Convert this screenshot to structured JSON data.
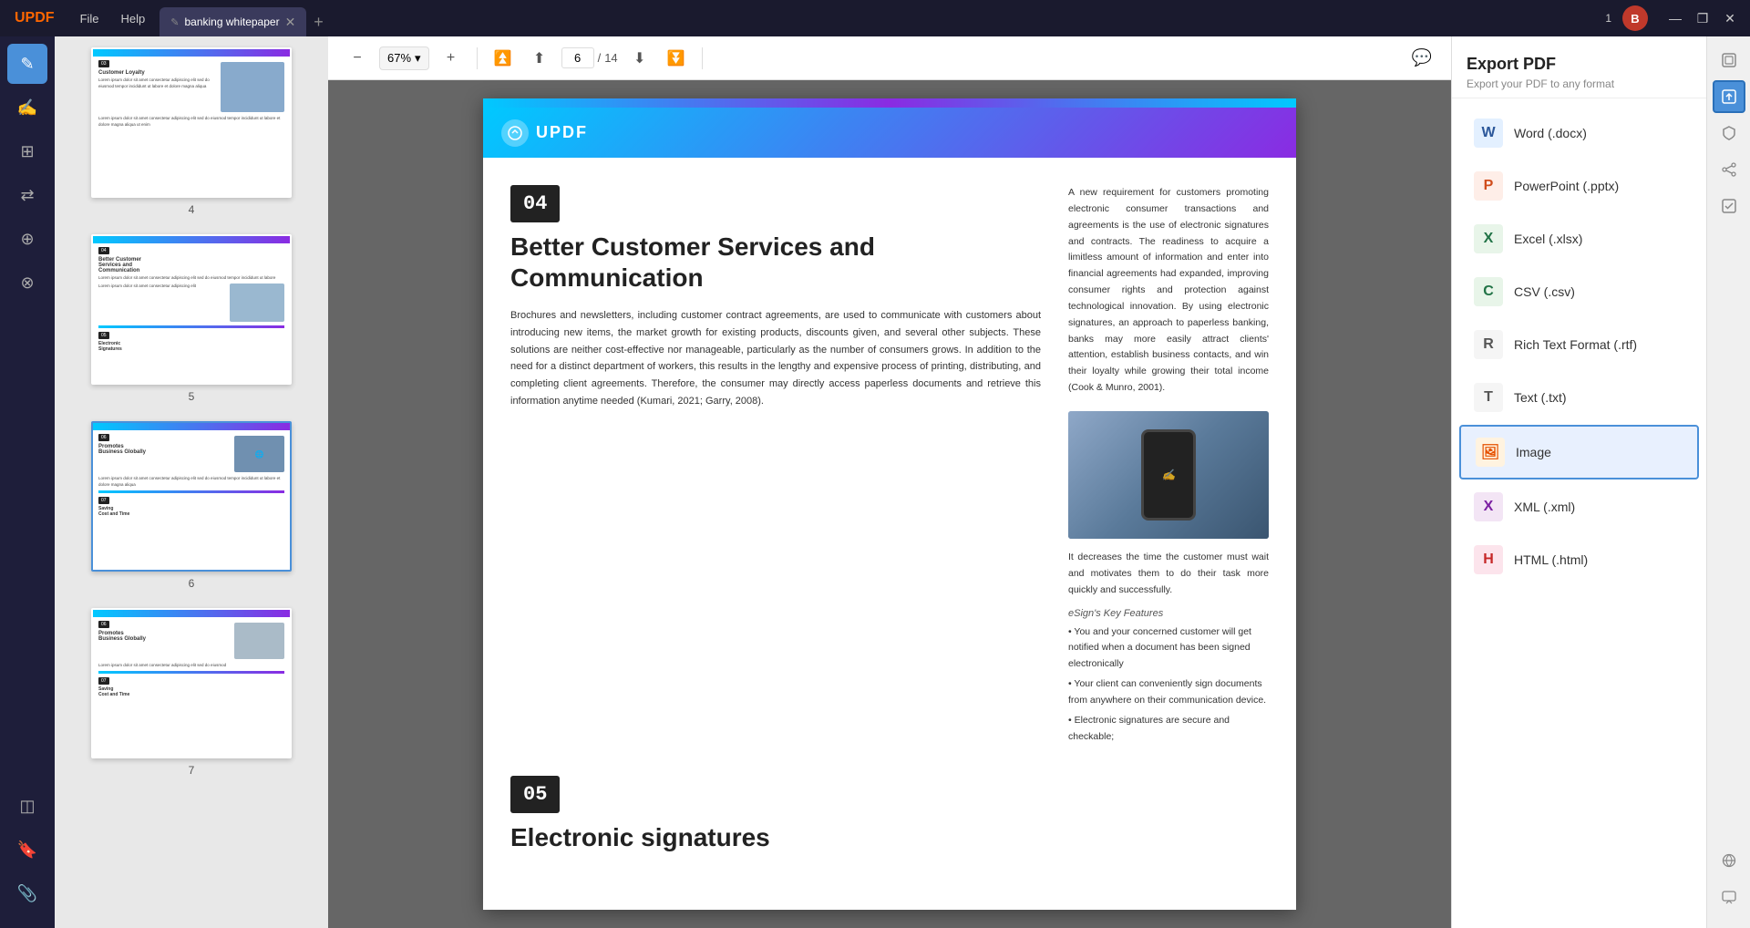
{
  "titlebar": {
    "logo": "UPDF",
    "menu": [
      "File",
      "Help"
    ],
    "tab": {
      "label": "banking whitepaper",
      "icon": "✎"
    },
    "add_tab_label": "+",
    "user_initial": "B",
    "window_controls": {
      "minimize": "—",
      "maximize": "❐",
      "close": "✕"
    },
    "page_indicator": "1"
  },
  "toolbar": {
    "zoom_out_label": "−",
    "zoom_in_label": "+",
    "zoom_level": "67%",
    "zoom_dropdown": "▾",
    "first_page_label": "⏮",
    "prev_page_label": "⬆",
    "next_page_label": "⬇",
    "last_page_label": "⏭",
    "current_page": "6",
    "total_pages": "14",
    "comment_label": "💬"
  },
  "right_panel": {
    "title": "Export PDF",
    "subtitle": "Export your PDF to any format",
    "items": [
      {
        "id": "word",
        "label": "Word (.docx)",
        "icon_text": "W",
        "icon_class": "export-icon-word"
      },
      {
        "id": "powerpoint",
        "label": "PowerPoint (.pptx)",
        "icon_text": "P",
        "icon_class": "export-icon-ppt"
      },
      {
        "id": "excel",
        "label": "Excel (.xlsx)",
        "icon_text": "X",
        "icon_class": "export-icon-excel"
      },
      {
        "id": "csv",
        "label": "CSV (.csv)",
        "icon_text": "C",
        "icon_class": "export-icon-csv"
      },
      {
        "id": "rtf",
        "label": "Rich Text Format (.rtf)",
        "icon_text": "R",
        "icon_class": "export-icon-rtf"
      },
      {
        "id": "txt",
        "label": "Text (.txt)",
        "icon_text": "T",
        "icon_class": "export-icon-txt"
      },
      {
        "id": "image",
        "label": "Image",
        "icon_text": "🖼",
        "icon_class": "export-icon-image",
        "active": true
      },
      {
        "id": "xml",
        "label": "XML (.xml)",
        "icon_text": "X",
        "icon_class": "export-icon-xml"
      },
      {
        "id": "html",
        "label": "HTML (.html)",
        "icon_text": "H",
        "icon_class": "export-icon-html"
      }
    ]
  },
  "pdf_page": {
    "updf_logo": "UPDF",
    "section04": {
      "number": "04",
      "title": "Better Customer Services and Communication",
      "body_left": "Brochures and newsletters, including customer contract agreements, are used to communicate with customers about introducing new items, the market growth for existing products, discounts given, and several other subjects. These solutions are neither cost-effective nor manageable, particularly as the number of consumers grows. In addition to the need for a distinct department of workers, this results in the lengthy and expensive process of printing, distributing, and completing client agreements. Therefore, the consumer may directly access paperless documents and retrieve this information anytime needed (Kumari, 2021; Garry, 2008).",
      "body_right": "A new requirement for customers promoting electronic consumer transactions and agreements is the use of electronic signatures and contracts. The readiness to acquire a limitless amount of information and enter into financial agreements had expanded, improving consumer rights and protection against technological innovation. By using electronic signatures, an approach to paperless banking, banks may more easily attract clients' attention, establish business contacts, and win their loyalty while growing their total income (Cook & Munro, 2001).",
      "image_caption": "",
      "decrease_text": "It decreases the time the customer must wait and motivates them to do their task more quickly and successfully.",
      "esign_title": "eSign's Key Features",
      "bullet1": "• You and your concerned customer will get notified when a document has been signed electronically",
      "bullet2": "• Your client can conveniently sign documents from anywhere on their communication device.",
      "bullet3": "• Electronic signatures are secure and checkable;"
    },
    "section05": {
      "number": "05",
      "title": "Electronic signatures"
    }
  },
  "thumbnails": [
    {
      "page_num": "4",
      "label": "4",
      "section_title": "Customer Loyalty",
      "section_num": "03"
    },
    {
      "page_num": "5",
      "label": "5",
      "section_title": "Better Customer Services and Communication",
      "section_num": "04"
    },
    {
      "page_num": "6",
      "label": "6",
      "section_title": "Electronic Signatures",
      "section_num": "05"
    },
    {
      "page_num": "7",
      "label": "7",
      "section_title": "Promotes Business Globally",
      "section_num": "06"
    }
  ],
  "sidebar": {
    "icons": [
      {
        "id": "edit",
        "symbol": "✎",
        "active": true
      },
      {
        "id": "annotate",
        "symbol": "✍",
        "active": false
      },
      {
        "id": "pages",
        "symbol": "⊞",
        "active": false
      },
      {
        "id": "convert",
        "symbol": "⇄",
        "active": false
      },
      {
        "id": "ocr",
        "symbol": "⊕",
        "active": false
      },
      {
        "id": "stamp",
        "symbol": "⊗",
        "active": false
      }
    ],
    "bottom": [
      {
        "id": "layers",
        "symbol": "◫"
      },
      {
        "id": "bookmark",
        "symbol": "🔖"
      },
      {
        "id": "attachment",
        "symbol": "📎"
      }
    ]
  }
}
